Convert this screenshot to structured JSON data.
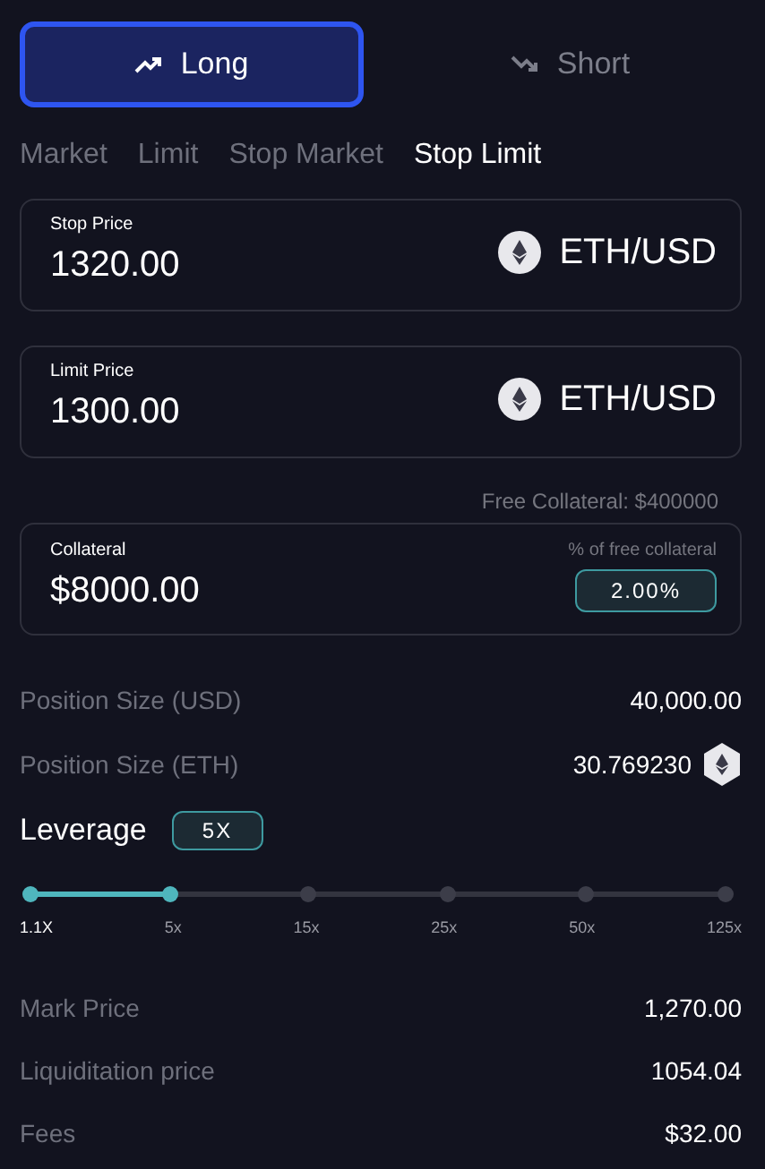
{
  "sides": [
    {
      "label": "Long",
      "kind": "up",
      "selected": true
    },
    {
      "label": "Short",
      "kind": "down",
      "selected": false
    }
  ],
  "order_types": [
    {
      "label": "Market",
      "selected": false
    },
    {
      "label": "Limit",
      "selected": false
    },
    {
      "label": "Stop Market",
      "selected": false
    },
    {
      "label": "Stop Limit",
      "selected": true
    }
  ],
  "price_fields": [
    {
      "label": "Stop Price",
      "value": "1320.00",
      "pair": "ETH/USD"
    },
    {
      "label": "Limit Price",
      "value": "1300.00",
      "pair": "ETH/USD"
    }
  ],
  "free_collateral": "Free Collateral: $400000",
  "collateral": {
    "label": "Collateral",
    "value": "$8000.00",
    "percent_label": "% of free collateral",
    "percent": "2.00%"
  },
  "position_rows": [
    {
      "label": "Position Size (USD)",
      "value": "40,000.00",
      "coin_icon": false
    },
    {
      "label": "Position Size (ETH)",
      "value": "30.769230",
      "coin_icon": true
    }
  ],
  "leverage": {
    "label": "Leverage",
    "value": "5X",
    "level": 0.2,
    "ticks": [
      "1.1X",
      "5x",
      "15x",
      "25x",
      "50x",
      "125x"
    ]
  },
  "summary_rows": [
    {
      "label": "Mark Price",
      "value": "1,270.00"
    },
    {
      "label": "Liquiditation price",
      "value": "1054.04"
    },
    {
      "label": "Fees",
      "value": "$32.00"
    }
  ]
}
